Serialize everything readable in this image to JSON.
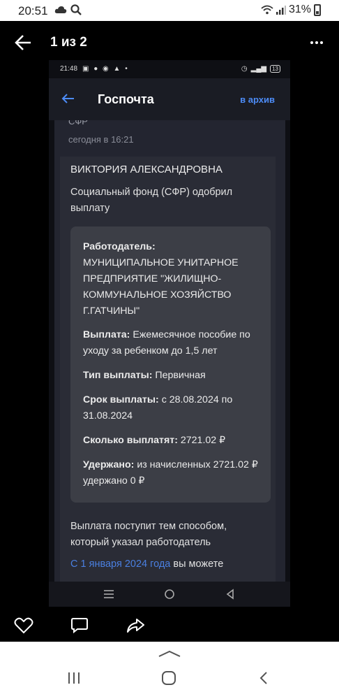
{
  "status_bar": {
    "time": "20:51",
    "battery": "31%",
    "icons": [
      "cloud-icon",
      "search-icon",
      "wifi-icon",
      "signal-icon",
      "battery-icon"
    ]
  },
  "viewer": {
    "page_counter": "1 из 2",
    "actions": [
      "like-icon",
      "comment-icon",
      "share-icon"
    ]
  },
  "inner_status": {
    "time": "21:48",
    "battery_level": "13"
  },
  "app_header": {
    "title": "Госпочта",
    "archive": "в архив"
  },
  "message": {
    "sender": "СФР",
    "date": "сегодня в 16:21",
    "recipient": "ВИКТОРИЯ АЛЕКСАНДРОВНА",
    "approval": "Социальный фонд (СФР) одобрил выплату",
    "employer_label": "Работодатель:",
    "employer_value": "МУНИЦИПАЛЬНОЕ УНИТАРНОЕ ПРЕДПРИЯТИЕ \"ЖИЛИЩНО-КОММУНАЛЬНОЕ ХОЗЯЙСТВО Г.ГАТЧИНЫ\"",
    "payment_label": "Выплата:",
    "payment_value": "Ежемесячное пособие по уходу за ребенком до 1,5 лет",
    "type_label": "Тип выплаты:",
    "type_value": "Первичная",
    "term_label": "Срок выплаты:",
    "term_value": "с 28.08.2024 по 31.08.2024",
    "amount_label": "Сколько выплатят:",
    "amount_value": "2721.02 ₽",
    "withheld_label": "Удержано:",
    "withheld_value": "из начисленных 2721.02 ₽ удержано 0 ₽",
    "footer_text": "Выплата поступит тем способом, который указал работодатель",
    "footer_link": "С 1 января 2024 года",
    "footer_tail": "вы можете"
  },
  "colors": {
    "accent_link": "#4d8cf7",
    "card_bg": "#2a2c36",
    "details_bg": "#3c3e46"
  }
}
